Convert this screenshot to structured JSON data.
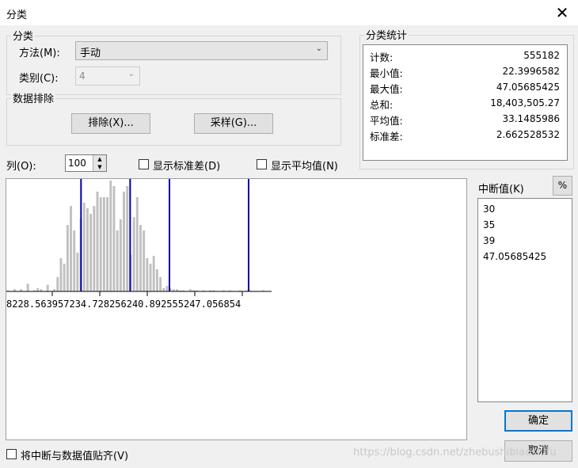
{
  "window": {
    "title": "分类",
    "close_glyph": "✕"
  },
  "classification": {
    "group_label": "分类",
    "method_label": "方法(M):",
    "method_value": "手动",
    "classes_label": "类别(C):",
    "classes_value": "4"
  },
  "exclusion": {
    "group_label": "数据排除",
    "exclude_button": "排除(X)...",
    "sample_button": "采样(G)..."
  },
  "statistics": {
    "group_label": "分类统计",
    "rows": [
      {
        "key": "计数:",
        "value": "555182"
      },
      {
        "key": "最小值:",
        "value": "22.3996582"
      },
      {
        "key": "最大值:",
        "value": "47.05685425"
      },
      {
        "key": "总和:",
        "value": "18,403,505.27"
      },
      {
        "key": "平均值:",
        "value": "33.1485986"
      },
      {
        "key": "标准差:",
        "value": "2.662528532"
      }
    ]
  },
  "columns": {
    "label": "列(O):",
    "value": "100"
  },
  "options": {
    "show_std_label": "显示标准差(D)",
    "show_mean_label": "显示平均值(N)",
    "snap_label": "将中断与数据值贴齐(V)"
  },
  "histogram": {
    "axis_text": "8228.563957234.728256240.892555247.056854",
    "bar_color": "#c0c0c0",
    "break_color": "#0000a8",
    "data_min": 22.3996582,
    "data_max": 47.05685425,
    "breaks": [
      30,
      35,
      39,
      47.05685425
    ],
    "bar_heights": [
      0.01,
      0.0,
      0.02,
      0.0,
      0.02,
      0.0,
      0.07,
      0.0,
      0.01,
      0.03,
      0.02,
      0.0,
      0.06,
      0.0,
      0.02,
      0.13,
      0.3,
      0.25,
      0.6,
      0.77,
      0.55,
      0.35,
      0.66,
      0.8,
      0.75,
      0.7,
      0.77,
      0.9,
      0.85,
      0.85,
      0.85,
      1.0,
      0.95,
      0.55,
      0.65,
      0.9,
      0.95,
      0.33,
      0.67,
      0.85,
      0.6,
      0.55,
      0.3,
      0.25,
      0.32,
      0.2,
      0.13,
      0.03,
      0.05,
      0.03,
      0.02,
      0.02,
      0.01,
      0.01,
      0.0,
      0.02,
      0.01,
      0.01,
      0.0,
      0.01,
      0.0,
      0.01,
      0.01,
      0.0,
      0.0,
      0.01,
      0.0,
      0.01,
      0.0,
      0.0,
      0.01,
      0.0,
      0.01,
      0.01,
      0.0,
      0.0,
      0.0,
      0.01,
      0.0,
      0.0
    ]
  },
  "breaks_panel": {
    "label": "中断值(K)",
    "percent_button": "%",
    "values": [
      "30",
      "35",
      "39",
      "47.05685425"
    ]
  },
  "buttons": {
    "ok": "确定",
    "cancel": "取消"
  },
  "watermark": "https://blog.csdn.net/zhebushibiaoshifu"
}
